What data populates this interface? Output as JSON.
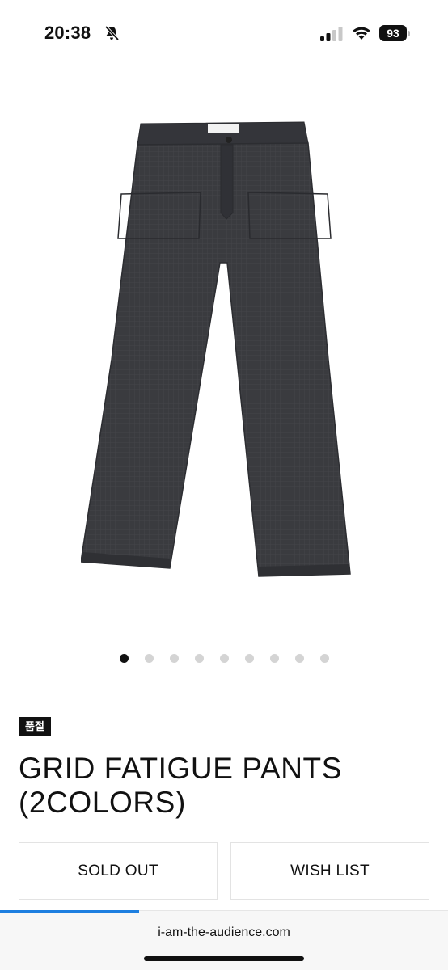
{
  "status_bar": {
    "time": "20:38",
    "battery_level": "93",
    "icons": [
      "bell-slash-icon",
      "signal-icon",
      "wifi-icon",
      "battery-icon"
    ]
  },
  "product": {
    "image_icon": "pants-image",
    "badge": "품절",
    "title_line1": "GRID FATIGUE PANTS",
    "title_line2": "(2COLORS)"
  },
  "carousel": {
    "total": 9,
    "active": 1
  },
  "actions": {
    "sold_out_label": "SOLD OUT",
    "wish_list_label": "WISH LIST"
  },
  "browser": {
    "url": "i-am-the-audience.com",
    "load_progress_fraction": 0.31,
    "accent_color": "#1d7fe0"
  }
}
